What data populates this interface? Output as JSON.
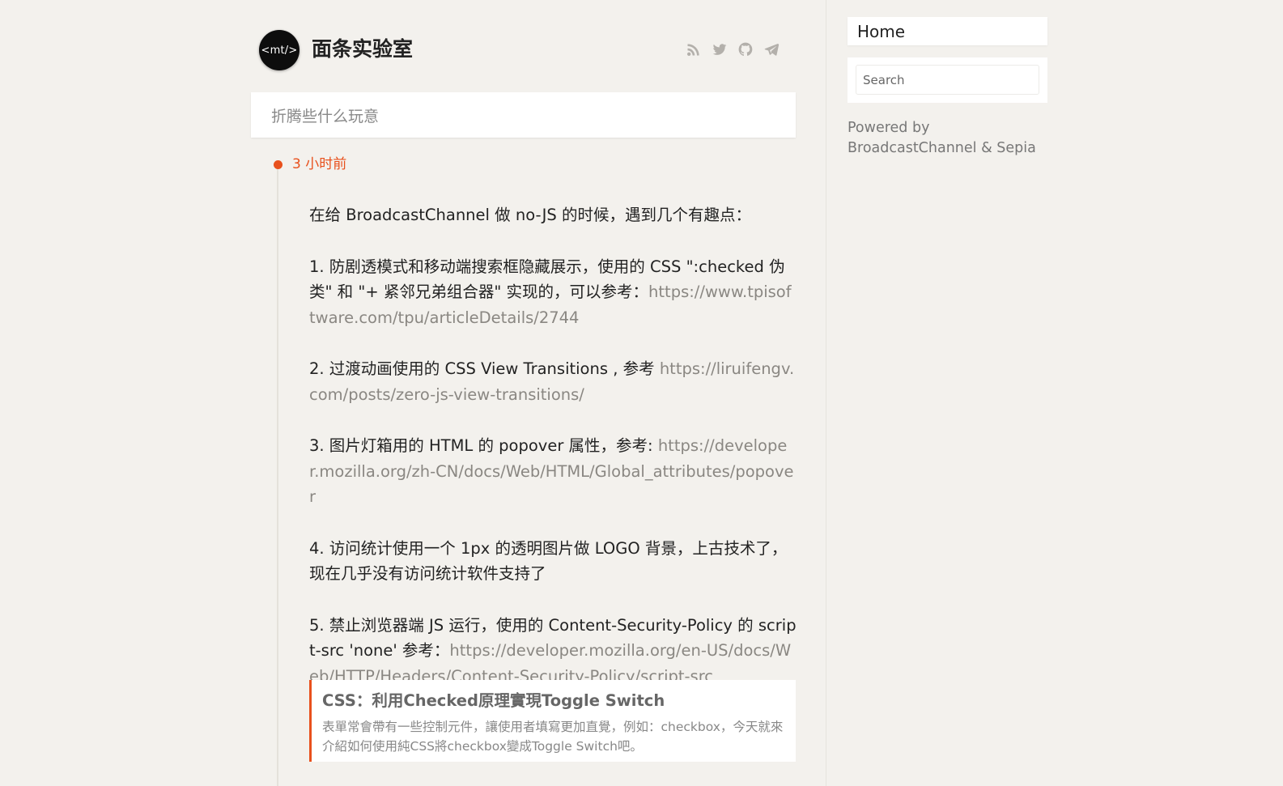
{
  "header": {
    "logo_text": "<mt/>",
    "site_title": "面条实验室",
    "social_icons": [
      "rss-icon",
      "twitter-icon",
      "github-icon",
      "telegram-icon"
    ]
  },
  "tagline": "折腾些什么玩意",
  "post": {
    "timestamp": "3 小时前",
    "intro": "在给 BroadcastChannel 做 no-JS 的时候，遇到几个有趣点：",
    "items": [
      {
        "text": "1. 防剧透模式和移动端搜索框隐藏展示，使用的 CSS \":checked 伪类\" 和 \"+ 紧邻兄弟组合器\" 实现的，可以参考：",
        "link": "https://www.tpisoftware.com/tpu/articleDetails/2744"
      },
      {
        "text": "2. 过渡动画使用的 CSS View Transitions , 参考 ",
        "link": "https://liruifengv.com/posts/zero-js-view-transitions/"
      },
      {
        "text": "3. 图片灯箱用的 HTML 的 popover 属性，参考: ",
        "link": "https://developer.mozilla.org/zh-CN/docs/Web/HTML/Global_attributes/popover"
      },
      {
        "text": "4. 访问统计使用一个 1px 的透明图片做 LOGO 背景，上古技术了，现在几乎没有访问统计软件支持了",
        "link": ""
      },
      {
        "text": "5. 禁止浏览器端 JS 运行，使用的 Content-Security-Policy 的 script-src 'none' 参考：",
        "link": "https://developer.mozilla.org/en-US/docs/Web/HTTP/Headers/Content-Security-Policy/script-src"
      }
    ],
    "preview": {
      "title": "CSS：利用Checked原理實現Toggle Switch",
      "description": "表單常會帶有一些控制元件，讓使用者填寫更加直覺，例如：checkbox，今天就來介紹如何使用純CSS將checkbox變成Toggle Switch吧。"
    }
  },
  "sidebar": {
    "home_label": "Home",
    "search_placeholder": "Search",
    "powered_by": "Powered by",
    "powered_link": "BroadcastChannel & Sepia"
  },
  "colors": {
    "background": "#f3f1ed",
    "accent": "#e8501c",
    "link": "#8a8782"
  }
}
